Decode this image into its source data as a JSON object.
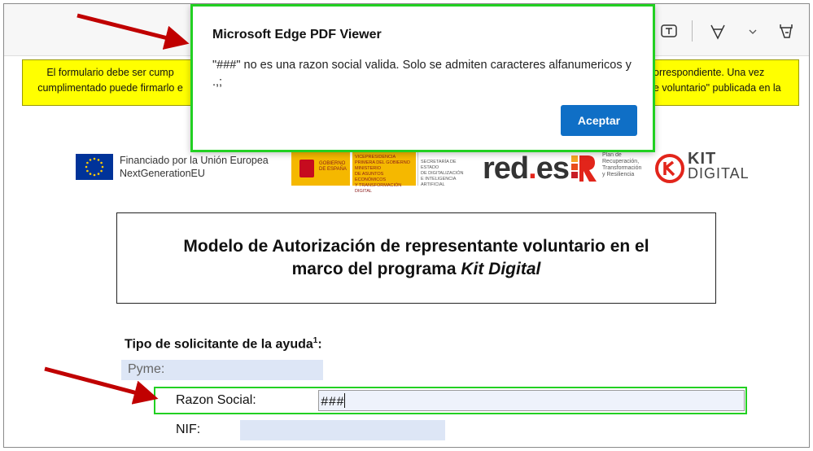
{
  "notice": {
    "left_lines": [
      "El formulario debe ser cump",
      "cumplimentado puede firmarlo e"
    ],
    "right_lines": [
      "orrespondiente. Una vez",
      "e voluntario\" publicada en la"
    ]
  },
  "logos": {
    "eu_line1": "Financiado por la Unión Europea",
    "eu_line2": "NextGenerationEU",
    "gov_line1": "GOBIERNO",
    "gov_line2": "DE ESPAÑA",
    "min_lines": [
      "VICEPRESIDENCIA",
      "PRIMERA DEL GOBIERNO",
      "MINISTERIO",
      "DE ASUNTOS ECONÓMICOS",
      "Y TRANSFORMACIÓN DIGITAL"
    ],
    "sec_lines": [
      "SECRETARÍA DE ESTADO",
      "DE DIGITALIZACIÓN",
      "E INTELIGENCIA ARTIFICIAL"
    ],
    "redes_main": "red",
    "redes_dot": ".",
    "redes_tail": "es",
    "tr_lines": [
      "Plan de",
      "Recuperación,",
      "Transformación",
      "y Resiliencia"
    ],
    "kit_line1": "KIT",
    "kit_line2": "DIGITAL"
  },
  "document": {
    "title_line1": "Modelo de Autorización de representante voluntario en el",
    "title_line2_plain": "marco del programa ",
    "title_line2_italic": "Kit Digital"
  },
  "form": {
    "heading": "Tipo de solicitante de la ayuda",
    "heading_sup": "1",
    "heading_suffix": ":",
    "pyme_label": "Pyme:",
    "razon_label": "Razon Social:",
    "razon_value": "###",
    "nif_label": "NIF:"
  },
  "dialog": {
    "title": "Microsoft Edge PDF Viewer",
    "message": "\"###\" no es una razon social valida. Solo se admiten caracteres alfanumericos y .,;",
    "button": "Aceptar"
  },
  "colors": {
    "highlight_border": "#22d022",
    "arrow": "#c00000",
    "notice_bg": "#ffff00",
    "primary_button": "#0f6fc6"
  },
  "icons": [
    "text-box-icon",
    "draw-icon",
    "chevron-down-icon",
    "highlight-icon"
  ]
}
